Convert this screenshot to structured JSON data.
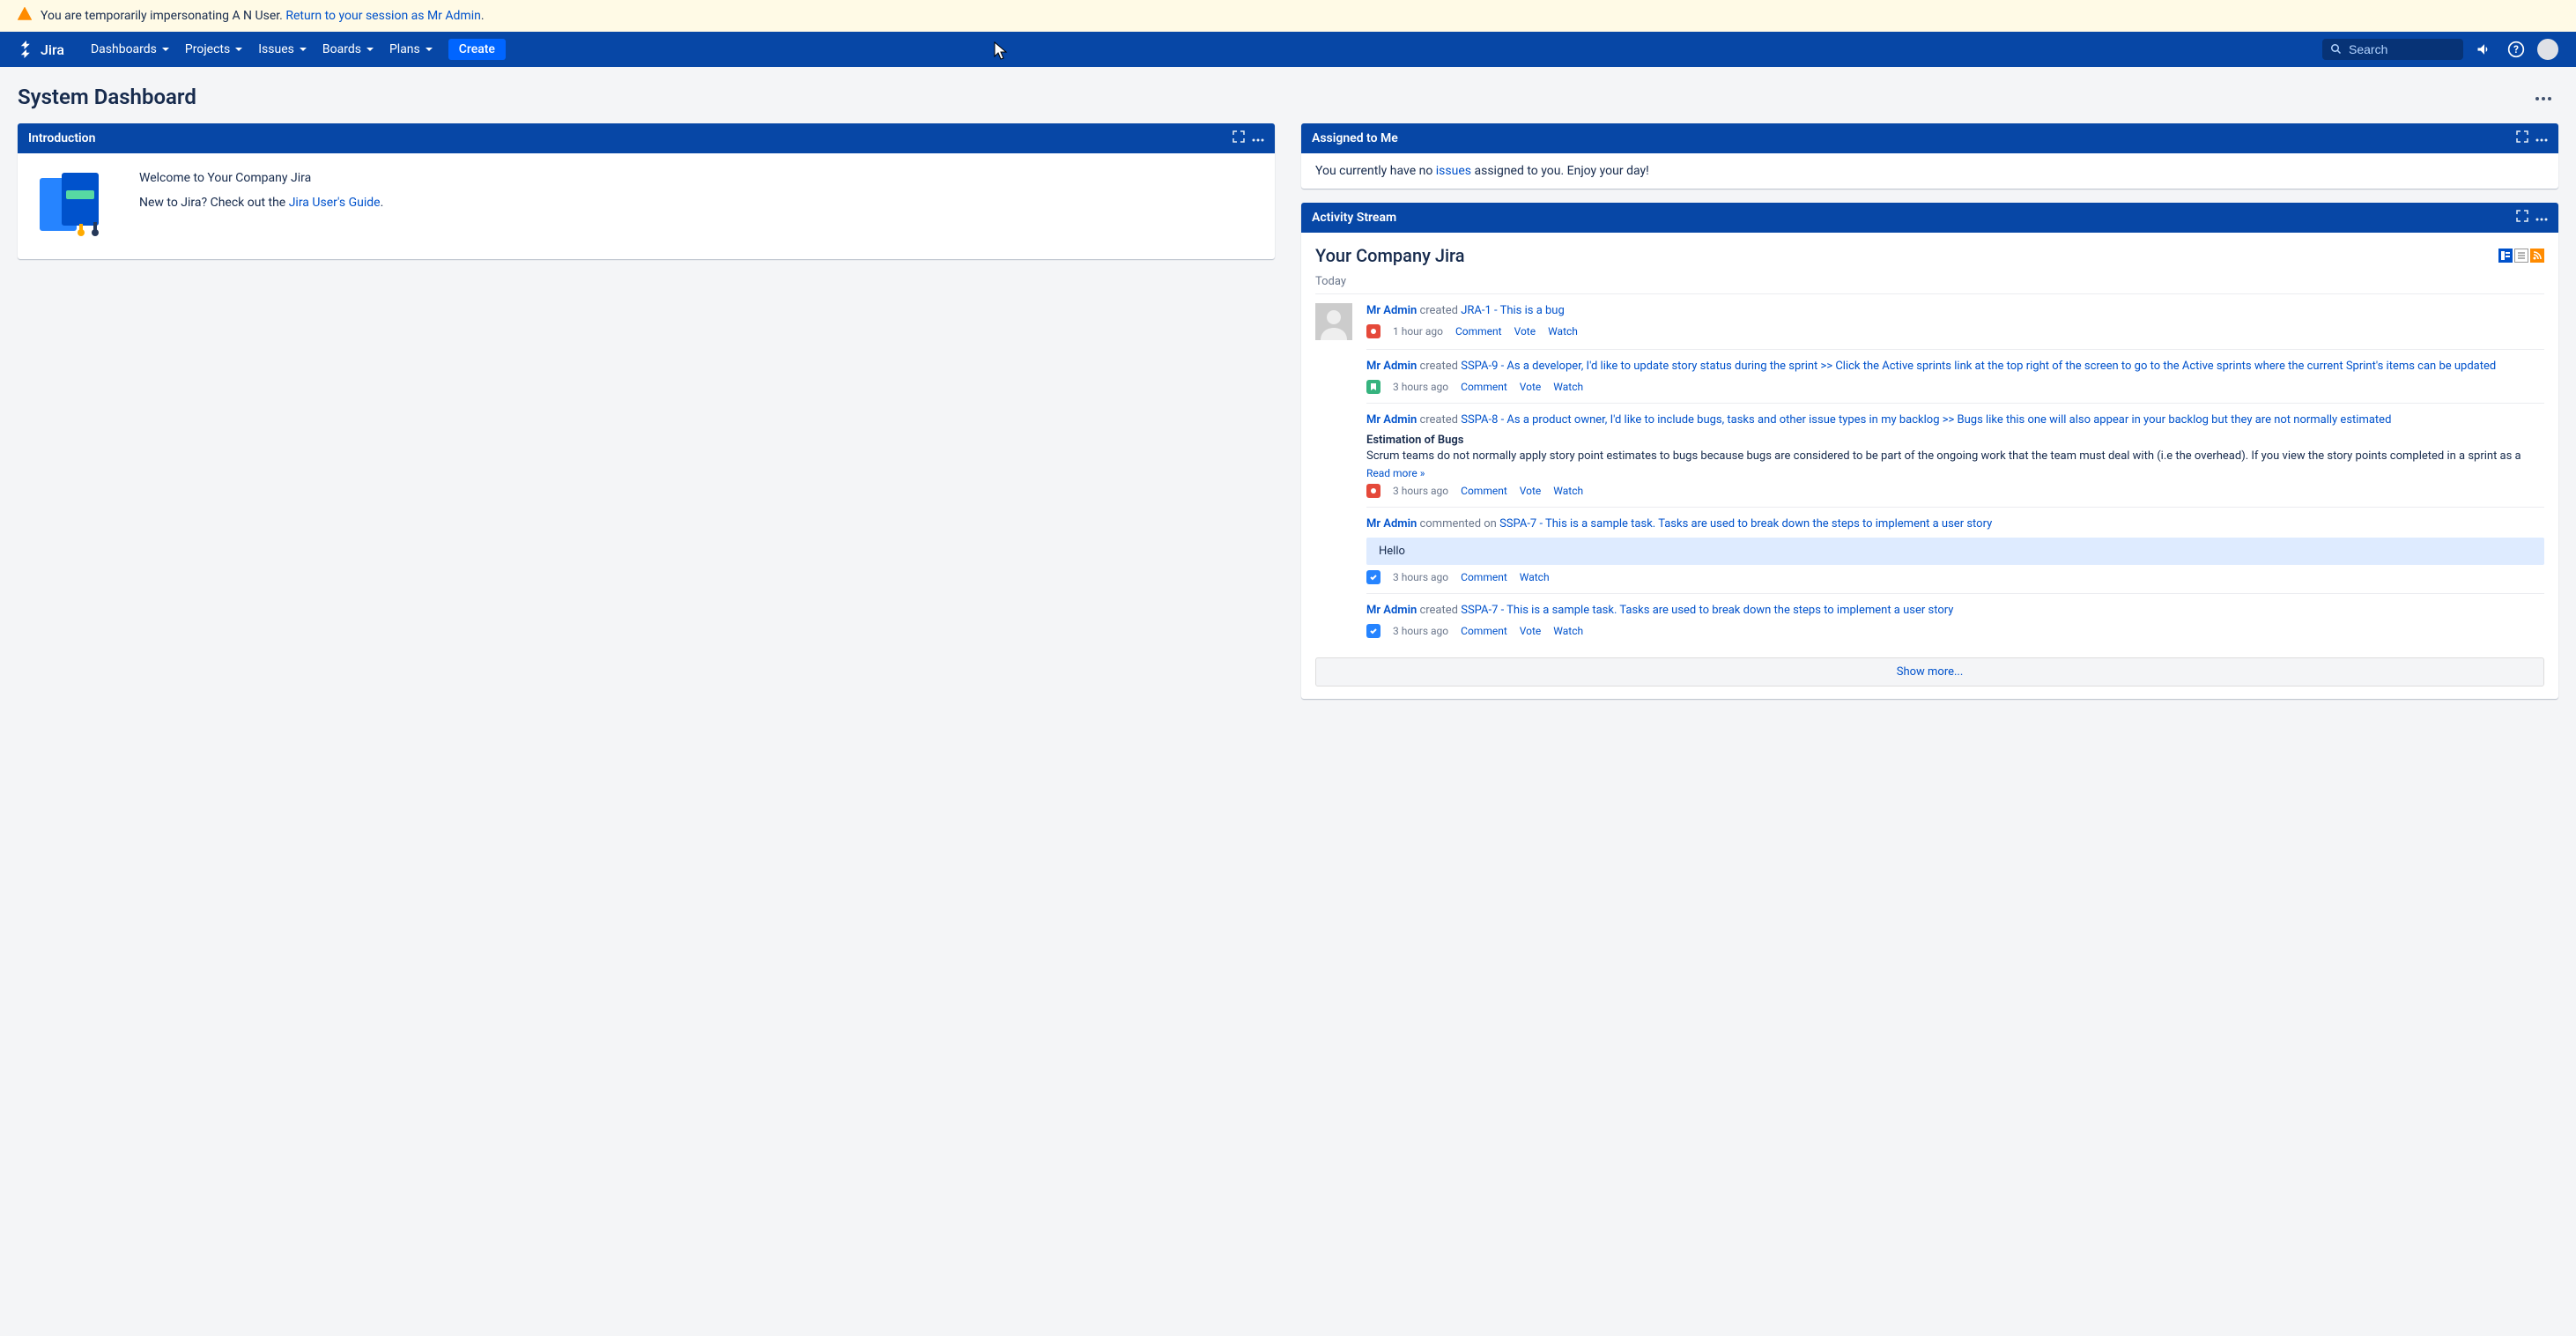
{
  "banner": {
    "prefix": "You are temporarily impersonating A N User. ",
    "link": "Return to your session as Mr Admin",
    "suffix": "."
  },
  "nav": {
    "logo": "Jira",
    "items": [
      "Dashboards",
      "Projects",
      "Issues",
      "Boards",
      "Plans"
    ],
    "create": "Create",
    "search_placeholder": "Search"
  },
  "page": {
    "title": "System Dashboard"
  },
  "intro": {
    "header": "Introduction",
    "welcome": "Welcome to Your Company Jira",
    "new_prefix": "New to Jira? Check out the ",
    "guide_link": "Jira User's Guide",
    "new_suffix": "."
  },
  "assigned": {
    "header": "Assigned to Me",
    "prefix": "You currently have no ",
    "link": "issues",
    "suffix": " assigned to you. Enjoy your day!"
  },
  "activity": {
    "header": "Activity Stream",
    "title": "Your Company Jira",
    "date_group": "Today",
    "show_more": "Show more...",
    "read_more": "Read more",
    "items": [
      {
        "user": "Mr Admin",
        "action": "created",
        "issue": "JRA-1 - This is a bug",
        "type": "bug",
        "time": "1 hour ago",
        "links": [
          "Comment",
          "Vote",
          "Watch"
        ],
        "has_avatar": true
      },
      {
        "user": "Mr Admin",
        "action": "created",
        "issue": "SSPA-9 - As a developer, I'd like to update story status during the sprint >> Click the Active sprints link at the top right of the screen to go to the Active sprints where the current Sprint's items can be updated",
        "type": "story",
        "time": "3 hours ago",
        "links": [
          "Comment",
          "Vote",
          "Watch"
        ]
      },
      {
        "user": "Mr Admin",
        "action": "created",
        "issue": "SSPA-8 - As a product owner, I'd like to include bugs, tasks and other issue types in my backlog >> Bugs like this one will also appear in your backlog but they are not normally estimated",
        "type": "bug",
        "time": "3 hours ago",
        "subtitle": "Estimation of Bugs",
        "desc": "Scrum teams do not normally apply story point estimates to bugs because bugs are considered to be part of the ongoing work that the team must deal with (i.e the overhead). If you view the story points completed in a sprint as a",
        "read_more": true,
        "links": [
          "Comment",
          "Vote",
          "Watch"
        ]
      },
      {
        "user": "Mr Admin",
        "action": "commented on",
        "issue": "SSPA-7 - This is a sample task. Tasks are used to break down the steps to implement a user story",
        "type": "task",
        "time": "3 hours ago",
        "comment": "Hello",
        "links": [
          "Comment",
          "Watch"
        ]
      },
      {
        "user": "Mr Admin",
        "action": "created",
        "issue": "SSPA-7 - This is a sample task. Tasks are used to break down the steps to implement a user story",
        "type": "task",
        "time": "3 hours ago",
        "links": [
          "Comment",
          "Vote",
          "Watch"
        ]
      }
    ]
  }
}
